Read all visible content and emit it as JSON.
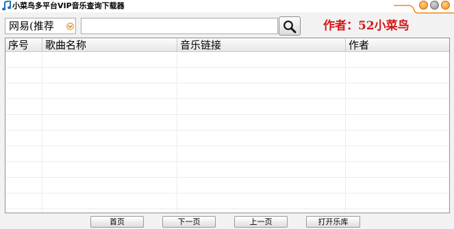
{
  "window": {
    "title": "小菜鸟多平台VIP音乐查询下载器",
    "icon": "music-note-icon",
    "controls": [
      "minimize-icon",
      "maximize-icon",
      "close-icon"
    ]
  },
  "toolbar": {
    "source_selected": "网易(推荐",
    "search_value": "",
    "search_icon": "magnifier-icon",
    "author_label": "作者：52小菜鸟"
  },
  "table": {
    "columns": [
      "序号",
      "歌曲名称",
      "音乐链接",
      "作者"
    ],
    "rows": []
  },
  "pager": {
    "first": "首页",
    "next": "下一页",
    "prev": "上一页",
    "open_library": "打开乐库"
  },
  "colors": {
    "author_red": "#d61515",
    "control_orange": "#f08a10",
    "control_gray": "#8a8a8a"
  }
}
